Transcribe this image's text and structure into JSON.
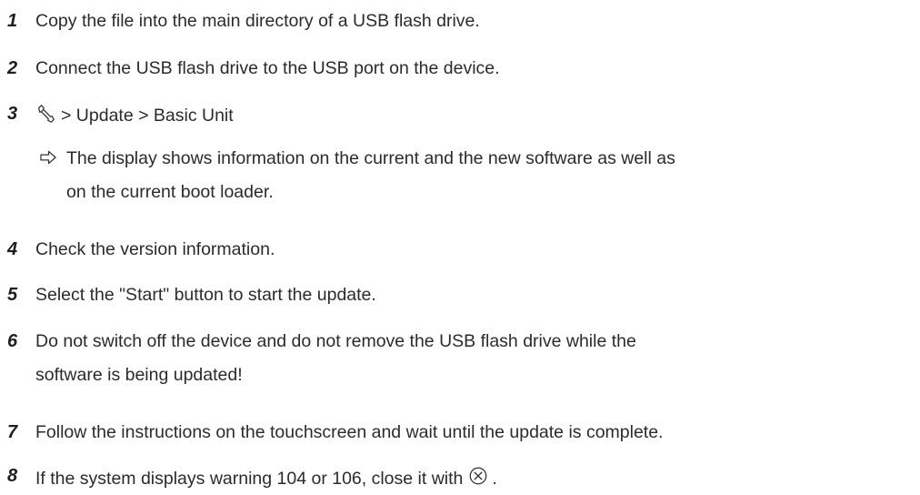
{
  "steps": [
    {
      "num": "1",
      "text": "Copy the file into the main directory of a USB flash drive."
    },
    {
      "num": "2",
      "text": "Connect the USB flash drive to the USB port on the device."
    },
    {
      "num": "3",
      "text": "> Update > Basic Unit",
      "icon": "wrench-icon"
    },
    {
      "num": "4",
      "text": "Check the version information."
    },
    {
      "num": "5",
      "text": "Select the \"Start\" button to start the update."
    },
    {
      "num": "6",
      "text": "Do not switch off the device and do not remove the USB flash drive while the",
      "text2": "software is being updated!"
    },
    {
      "num": "7",
      "text": "Follow the instructions on the touchscreen and wait until the update is complete."
    },
    {
      "num": "8",
      "text": "If the system displays warning 104 or 106, close it with",
      "text_end": ".",
      "icon": "close-circle-icon"
    }
  ],
  "result": {
    "icon": "result-arrow-icon",
    "text": "The display shows information on the current and the new software as well as",
    "text2": "on the current boot loader."
  }
}
